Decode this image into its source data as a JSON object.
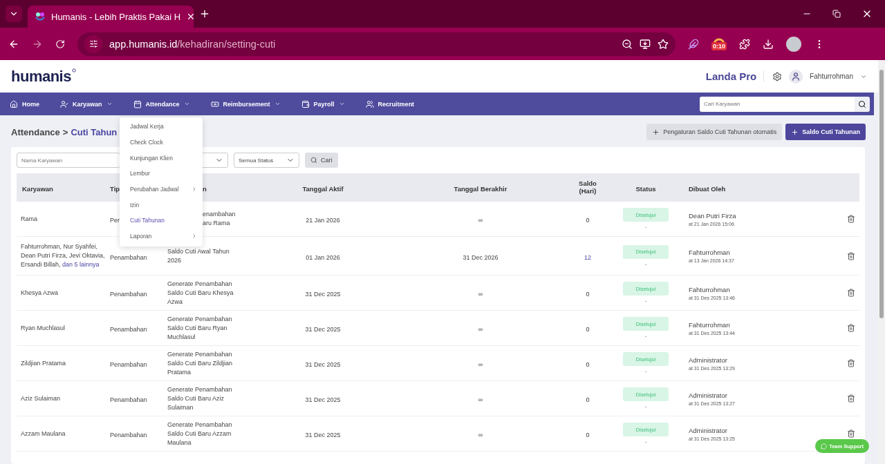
{
  "browser": {
    "tab_title": "Humanis - Lebih Praktis Pakai H",
    "url_host": "app.humanis.id",
    "url_path": "/kehadiran/setting-cuti",
    "extension_badge": "0:10"
  },
  "header": {
    "logo": "humanis",
    "company": "Landa Pro",
    "user": "Fahturrohman"
  },
  "nav": {
    "items": [
      {
        "label": "Home",
        "has_dropdown": false
      },
      {
        "label": "Karyawan",
        "has_dropdown": true
      },
      {
        "label": "Attendance",
        "has_dropdown": true
      },
      {
        "label": "Reimbursement",
        "has_dropdown": true
      },
      {
        "label": "Payroll",
        "has_dropdown": true
      },
      {
        "label": "Recruitment",
        "has_dropdown": false
      }
    ],
    "search": {
      "placeholder": "Cari Karyawan"
    }
  },
  "breadcrumb": {
    "parent": "Attendance",
    "separator": ">",
    "current": "Cuti Tahun"
  },
  "actions": [
    {
      "label": "Pengaturan Saldo Cuti Tahunan otomatis",
      "primary": false
    },
    {
      "label": "Saldo Cuti Tahunan",
      "primary": true
    }
  ],
  "filters": {
    "name_placeholder": "Nama Karyawan",
    "status_select": "Semua Status",
    "search_button": "Cari"
  },
  "menu": {
    "items": [
      {
        "label": "Jadwal Kerja",
        "selected": false,
        "has_submenu": false
      },
      {
        "label": "Check Clock",
        "selected": false,
        "has_submenu": false
      },
      {
        "label": "Kunjungan Klien",
        "selected": false,
        "has_submenu": false
      },
      {
        "label": "Lembur",
        "selected": false,
        "has_submenu": false
      },
      {
        "label": "Perubahan Jadwal",
        "selected": false,
        "has_submenu": true
      },
      {
        "label": "Izin",
        "selected": false,
        "has_submenu": false
      },
      {
        "label": "Cuti Tahunan",
        "selected": true,
        "has_submenu": false
      },
      {
        "label": "Laporan",
        "selected": false,
        "has_submenu": true
      }
    ]
  },
  "table": {
    "columns": [
      {
        "label": "Karyawan"
      },
      {
        "label": "Tip"
      },
      {
        "label": "n",
        "covered": true
      },
      {
        "label": "Tanggal Aktif"
      },
      {
        "label": "Tanggal Berakhir"
      },
      {
        "label": "Saldo (Hari)"
      },
      {
        "label": "Status"
      },
      {
        "label": "Dibuat Oleh"
      }
    ],
    "rows": [
      {
        "karyawan": "Rama",
        "tipe": "Per",
        "keterangan": "enambahan\naru Rama",
        "covered": true,
        "tanggal_aktif": "21 Jan 2026",
        "tanggal_berakhir": "∞",
        "saldo": "0",
        "saldo_link": false,
        "status": "Disetujui",
        "status_note": "-",
        "dibuat_oleh": "Dean Putri Firza",
        "dibuat_at": "at 21 Jan 2026 15:06"
      },
      {
        "karyawan": "Fahturrohman, Nur Syahfei, Dean Putri Firza, Jevi Oktavia, Ersandi Billah,",
        "more": "dan 5 lainnya",
        "tipe": "Penambahan",
        "keterangan": "Saldo Cuti Awal Tahun 2026",
        "covered": false,
        "tanggal_aktif": "01 Jan 2026",
        "tanggal_berakhir": "31 Dec 2026",
        "saldo": "12",
        "saldo_link": true,
        "status": "Disetujui",
        "status_note": "-",
        "dibuat_oleh": "Fahturrohman",
        "dibuat_at": "at 13 Jan 2026 14:37"
      },
      {
        "karyawan": "Khesya Azwa",
        "tipe": "Penambahan",
        "keterangan": "Generate Penambahan Saldo Cuti Baru Khesya Azwa",
        "covered": false,
        "tanggal_aktif": "31 Dec 2025",
        "tanggal_berakhir": "∞",
        "saldo": "0",
        "saldo_link": false,
        "status": "Disetujui",
        "status_note": "-",
        "dibuat_oleh": "Fahturrohman",
        "dibuat_at": "at 31 Des 2025 13:46"
      },
      {
        "karyawan": "Ryan Muchlasul",
        "tipe": "Penambahan",
        "keterangan": "Generate Penambahan Saldo Cuti Baru Ryan Muchlasul",
        "covered": false,
        "tanggal_aktif": "31 Dec 2025",
        "tanggal_berakhir": "∞",
        "saldo": "0",
        "saldo_link": false,
        "status": "Disetujui",
        "status_note": "-",
        "dibuat_oleh": "Fahturrohman",
        "dibuat_at": "at 31 Des 2025 13:44"
      },
      {
        "karyawan": "Zildjian Pratama",
        "tipe": "Penambahan",
        "keterangan": "Generate Penambahan Saldo Cuti Baru Zildjian Pratama",
        "covered": false,
        "tanggal_aktif": "31 Dec 2025",
        "tanggal_berakhir": "∞",
        "saldo": "0",
        "saldo_link": false,
        "status": "Disetujui",
        "status_note": "-",
        "dibuat_oleh": "Administrator",
        "dibuat_at": "at 31 Des 2025 13:29"
      },
      {
        "karyawan": "Aziz Sulaiman",
        "tipe": "Penambahan",
        "keterangan": "Generate Penambahan Saldo Cuti Baru Aziz Sulaiman",
        "covered": false,
        "tanggal_aktif": "31 Dec 2025",
        "tanggal_berakhir": "∞",
        "saldo": "0",
        "saldo_link": false,
        "status": "Disetujui",
        "status_note": "-",
        "dibuat_oleh": "Administrator",
        "dibuat_at": "at 31 Des 2025 13:27"
      },
      {
        "karyawan": "Azzam Maulana",
        "tipe": "Penambahan",
        "keterangan": "Generate Penambahan Saldo Cuti Baru Azzam Maulana",
        "covered": false,
        "tanggal_aktif": "31 Dec 2025",
        "tanggal_berakhir": "∞",
        "saldo": "0",
        "saldo_link": false,
        "status": "Disetujui",
        "status_note": "-",
        "dibuat_oleh": "Administrator",
        "dibuat_at": "at 31 Des 2025 13:25"
      }
    ]
  },
  "support_button": "Team Support"
}
